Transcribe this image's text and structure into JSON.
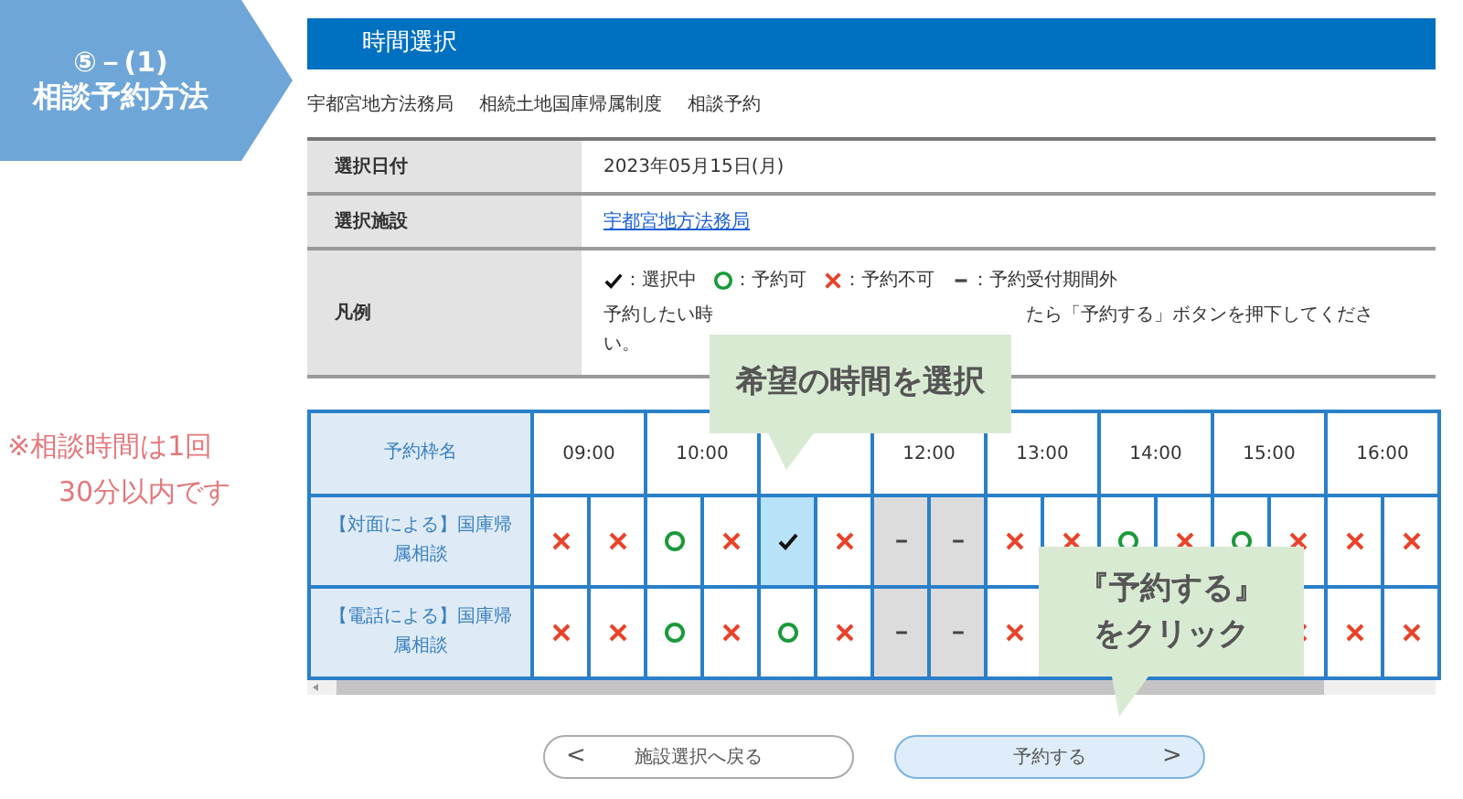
{
  "section_banner": {
    "step": "⑤－(1)",
    "title": "相談予約方法"
  },
  "side_note": [
    "※相談時間は1回",
    "30分以内です"
  ],
  "page_title": "時間選択",
  "breadcrumb": [
    "宇都宮地方法務局",
    "相続土地国庫帰属制度",
    "相談予約"
  ],
  "info": [
    {
      "label": "選択日付",
      "value": "2023年05月15日(月)",
      "kind": "text"
    },
    {
      "label": "選択施設",
      "value": "宇都宮地方法務局",
      "kind": "link"
    }
  ],
  "legend": {
    "label": "凡例",
    "items": [
      {
        "kind": "check",
        "label": "：選択中"
      },
      {
        "kind": "available",
        "label": "：予約可"
      },
      {
        "kind": "full",
        "label": "：予約不可"
      },
      {
        "kind": "closed",
        "label": "：予約受付期間外"
      }
    ],
    "note_before": "予約したい時",
    "note_after": "たら「予約する」ボタンを押下してください。"
  },
  "slots": {
    "name_header": "予約枠名",
    "hours": [
      {
        "kind": "time",
        "label": "09:00"
      },
      {
        "kind": "time",
        "label": "10:00"
      },
      {
        "kind": "covered"
      },
      {
        "kind": "time",
        "label": "12:00"
      },
      {
        "kind": "time",
        "label": "13:00"
      },
      {
        "kind": "time",
        "label": "14:00"
      },
      {
        "kind": "time",
        "label": "15:00"
      },
      {
        "kind": "time",
        "label": "16:00"
      }
    ],
    "rows": [
      {
        "name": "【対面による】国庫帰属相談",
        "cells": [
          {
            "kind": "full"
          },
          {
            "kind": "full"
          },
          {
            "kind": "available"
          },
          {
            "kind": "full"
          },
          {
            "kind": "check"
          },
          {
            "kind": "full"
          },
          {
            "kind": "closed"
          },
          {
            "kind": "closed"
          },
          {
            "kind": "full"
          },
          {
            "kind": "full"
          },
          {
            "kind": "available"
          },
          {
            "kind": "full"
          },
          {
            "kind": "available"
          },
          {
            "kind": "full"
          },
          {
            "kind": "full"
          },
          {
            "kind": "full"
          }
        ]
      },
      {
        "name": "【電話による】国庫帰属相談",
        "cells": [
          {
            "kind": "full"
          },
          {
            "kind": "full"
          },
          {
            "kind": "available"
          },
          {
            "kind": "full"
          },
          {
            "kind": "available"
          },
          {
            "kind": "full"
          },
          {
            "kind": "closed"
          },
          {
            "kind": "closed"
          },
          {
            "kind": "full"
          },
          {
            "kind": "covered"
          },
          {
            "kind": "covered"
          },
          {
            "kind": "covered"
          },
          {
            "kind": "covered"
          },
          {
            "kind": "full"
          },
          {
            "kind": "full"
          },
          {
            "kind": "full"
          }
        ]
      }
    ]
  },
  "buttons": [
    {
      "label": "施設選択へ戻る",
      "arrow": "<",
      "kind": "back"
    },
    {
      "label": "予約する",
      "arrow": ">",
      "kind": "primary"
    }
  ],
  "callouts": [
    {
      "lines": [
        "希望の時間を選択"
      ]
    },
    {
      "lines": [
        "『予約する』",
        "をクリック"
      ]
    }
  ]
}
